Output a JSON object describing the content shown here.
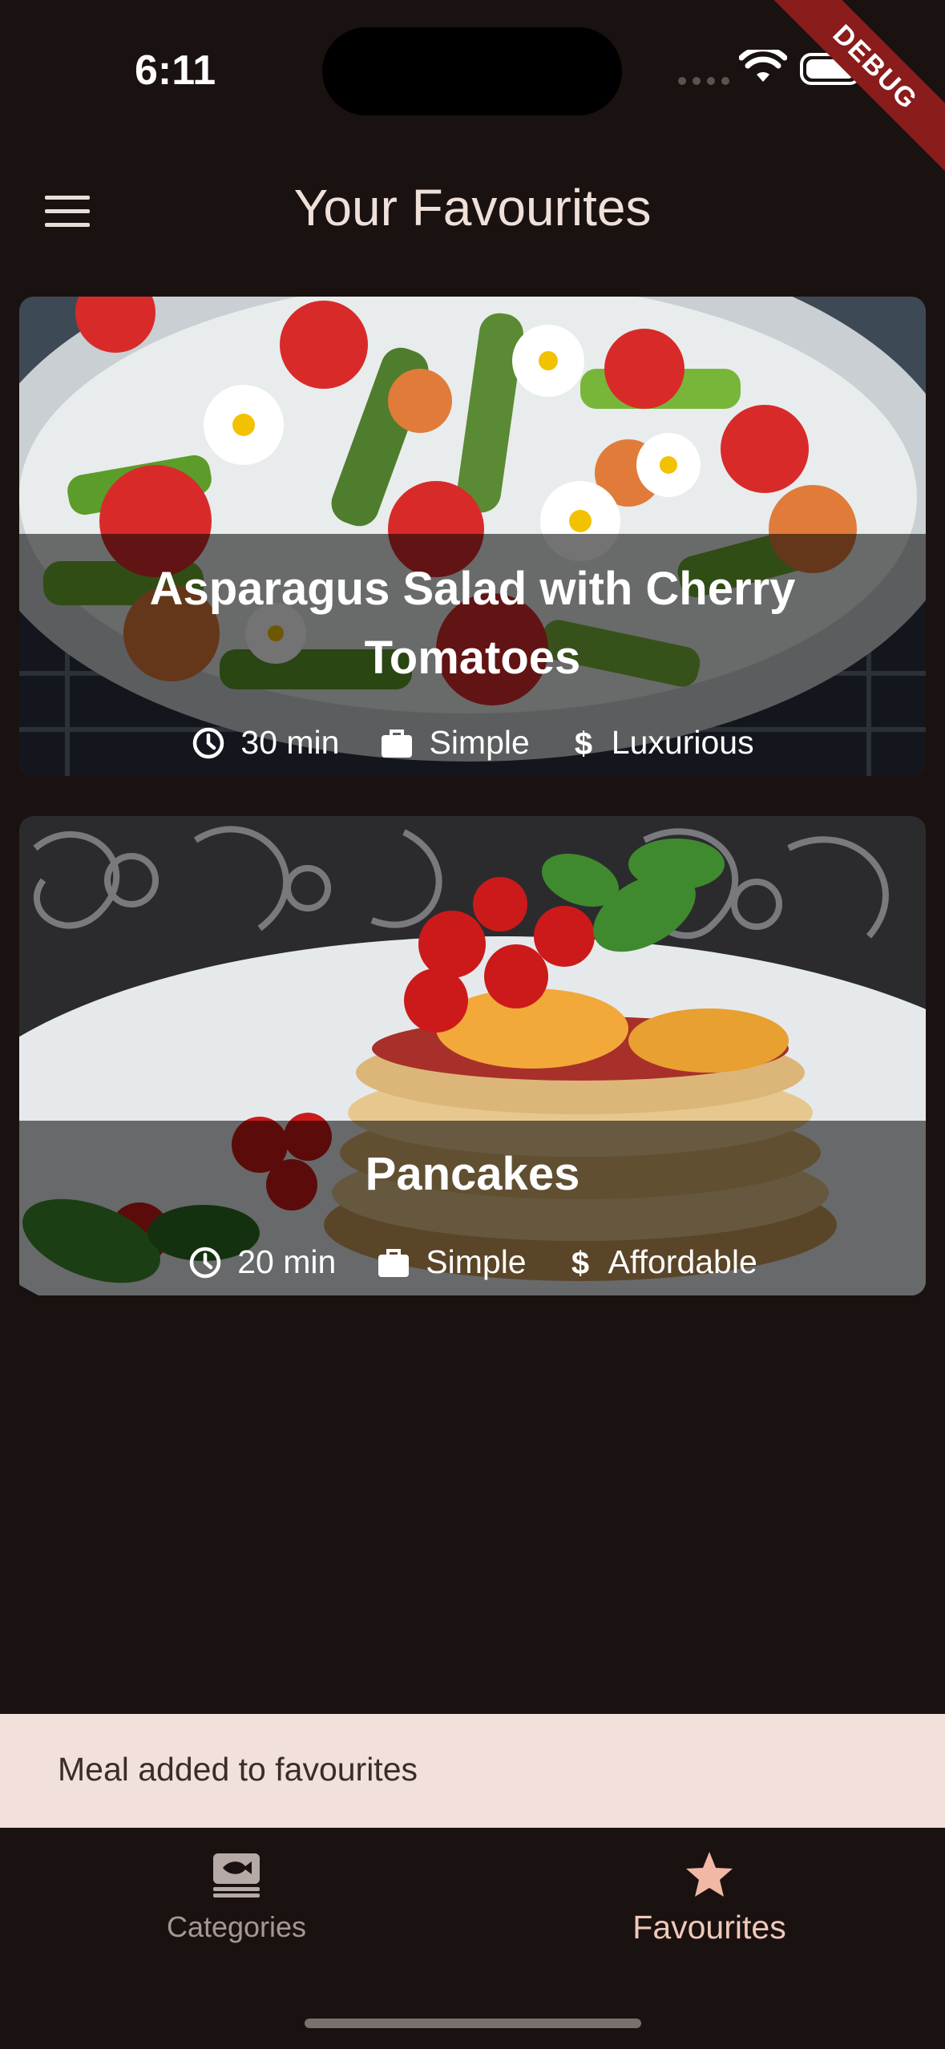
{
  "status_bar": {
    "time": "6:11"
  },
  "debug_banner": "DEBUG",
  "app_bar": {
    "title": "Your Favourites"
  },
  "meals": [
    {
      "title": "Asparagus Salad with Cherry Tomatoes",
      "duration": "30 min",
      "complexity": "Simple",
      "affordability": "Luxurious"
    },
    {
      "title": "Pancakes",
      "duration": "20 min",
      "complexity": "Simple",
      "affordability": "Affordable"
    }
  ],
  "snackbar": {
    "message": "Meal added to favourites"
  },
  "bottom_nav": {
    "categories_label": "Categories",
    "favourites_label": "Favourites"
  },
  "colors": {
    "background": "#1a1210",
    "snackbar": "#f2e0da",
    "active_tab": "#f0c8ba",
    "inactive_tab": "#a59893"
  },
  "icons": [
    "menu-icon",
    "clock-icon",
    "briefcase-icon",
    "dollar-icon",
    "categories-icon",
    "star-icon",
    "wifi-icon",
    "battery-icon"
  ]
}
